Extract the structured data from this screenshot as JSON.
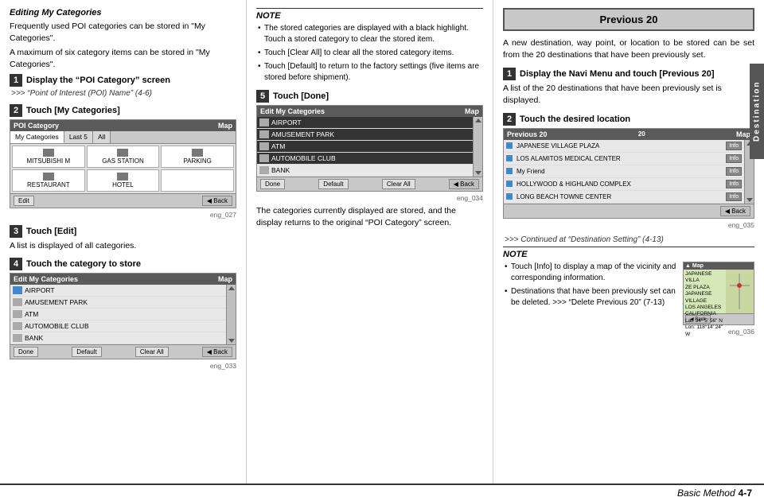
{
  "left_col": {
    "editing_title": "Editing My Categories",
    "editing_body1": "Frequently used POI categories can be stored in \"My Categories\".",
    "editing_body2": "A maximum of six category items can be stored in \"My Categories\".",
    "step1": {
      "num": "1",
      "label": "Display the “POI Category” screen",
      "subtext": ">>> “Point of Interest (POI) Name” (4-6)"
    },
    "step2": {
      "num": "2",
      "label": "Touch [My Categories]",
      "screen": {
        "header_left": "POI Category",
        "header_right": "Map",
        "tabs": [
          "My Categories",
          "Last 5",
          "All"
        ],
        "grid_items": [
          {
            "icon": true,
            "label": "MITSUBISHI M"
          },
          {
            "icon": true,
            "label": "GAS STATION"
          },
          {
            "icon": true,
            "label": "PARKING"
          },
          {
            "icon": true,
            "label": "RESTAURANT"
          },
          {
            "icon": true,
            "label": "HOTEL"
          },
          {
            "icon": false,
            "label": ""
          }
        ],
        "footer_btn": "Edit",
        "footer_back": "Back"
      },
      "caption": "eng_027"
    },
    "step3": {
      "num": "3",
      "label": "Touch [Edit]",
      "body": "A list is displayed of all categories."
    },
    "step4": {
      "num": "4",
      "label": "Touch the category to store",
      "screen": {
        "header_left": "Edit My Categories",
        "header_right": "Map",
        "rows": [
          "AIRPORT",
          "AMUSEMENT PARK",
          "ATM",
          "AUTOMOBILE CLUB",
          "BANK"
        ],
        "footer_btn1": "Done",
        "footer_btn2": "Default",
        "footer_btn3": "Clear All",
        "footer_back": "Back"
      },
      "caption": "eng_033"
    }
  },
  "middle_col": {
    "note_title": "NOTE",
    "note_bullets": [
      "The stored categories are displayed with a black highlight. Touch a stored category to clear the stored item.",
      "Touch [Clear All] to clear all the stored category items.",
      "Touch [Default] to return to the factory settings (five items are stored before shipment)."
    ],
    "step5": {
      "num": "5",
      "label": "Touch [Done]",
      "screen": {
        "header_left": "Edit My Categories",
        "header_right": "Map",
        "rows": [
          "AIRPORT",
          "AMUSEMENT PARK",
          "ATM",
          "AUTOMOBILE CLUB",
          "BANK"
        ],
        "highlighted": [
          0,
          1,
          2,
          3
        ],
        "footer_btn1": "Done",
        "footer_btn2": "Default",
        "footer_btn3": "Clear All",
        "footer_back": "Back"
      },
      "caption": "eng_034"
    },
    "step5_body1": "The categories currently displayed are stored, and the display returns to the original “POI Category” screen."
  },
  "right_col": {
    "previous20_title": "Previous 20",
    "previous20_body": "A new destination, way point, or location to be stored can be set from the 20 destinations that have been previously set.",
    "step1": {
      "num": "1",
      "label": "Display the Navi Menu and touch [Previous 20]",
      "body": "A list of the 20 destinations that have been previously set is displayed."
    },
    "step2": {
      "num": "2",
      "label": "Touch the desired location",
      "screen": {
        "header_left": "Previous 20",
        "header_num": "20",
        "header_right": "Map",
        "rows": [
          "JAPANESE VILLAGE PLAZA",
          "LOS ALAMITOS MEDICAL CENTER",
          "My Friend",
          "HOLLYWOOD & HIGHLAND COMPLEX",
          "LONG BEACH TOWNE CENTER"
        ],
        "footer_back": "Back"
      },
      "caption": "eng_035"
    },
    "continued_text": ">>> Continued at “Destination Setting” (4-13)",
    "note_title": "NOTE",
    "note_bullets": [
      "Touch [Info] to display a map of the vicinity and corresponding information.",
      "Destinations that have been previously set can be deleted. >>> “Delete Previous 20” (7-13)"
    ],
    "map_info_screen": {
      "caption": "eng_036",
      "lines": [
        "JAPANESE VILLA",
        "ZE PLAZA",
        "JAPANESE VILLAGE",
        "LOS ANGELES",
        "CALIFORNIA",
        "Lat: 34° 5' 56\" N",
        "Lon: 118° 14' 24\" W"
      ]
    }
  },
  "bottom": {
    "label": "Basic Method",
    "page": "4-7"
  },
  "destination_tab": "Destination"
}
